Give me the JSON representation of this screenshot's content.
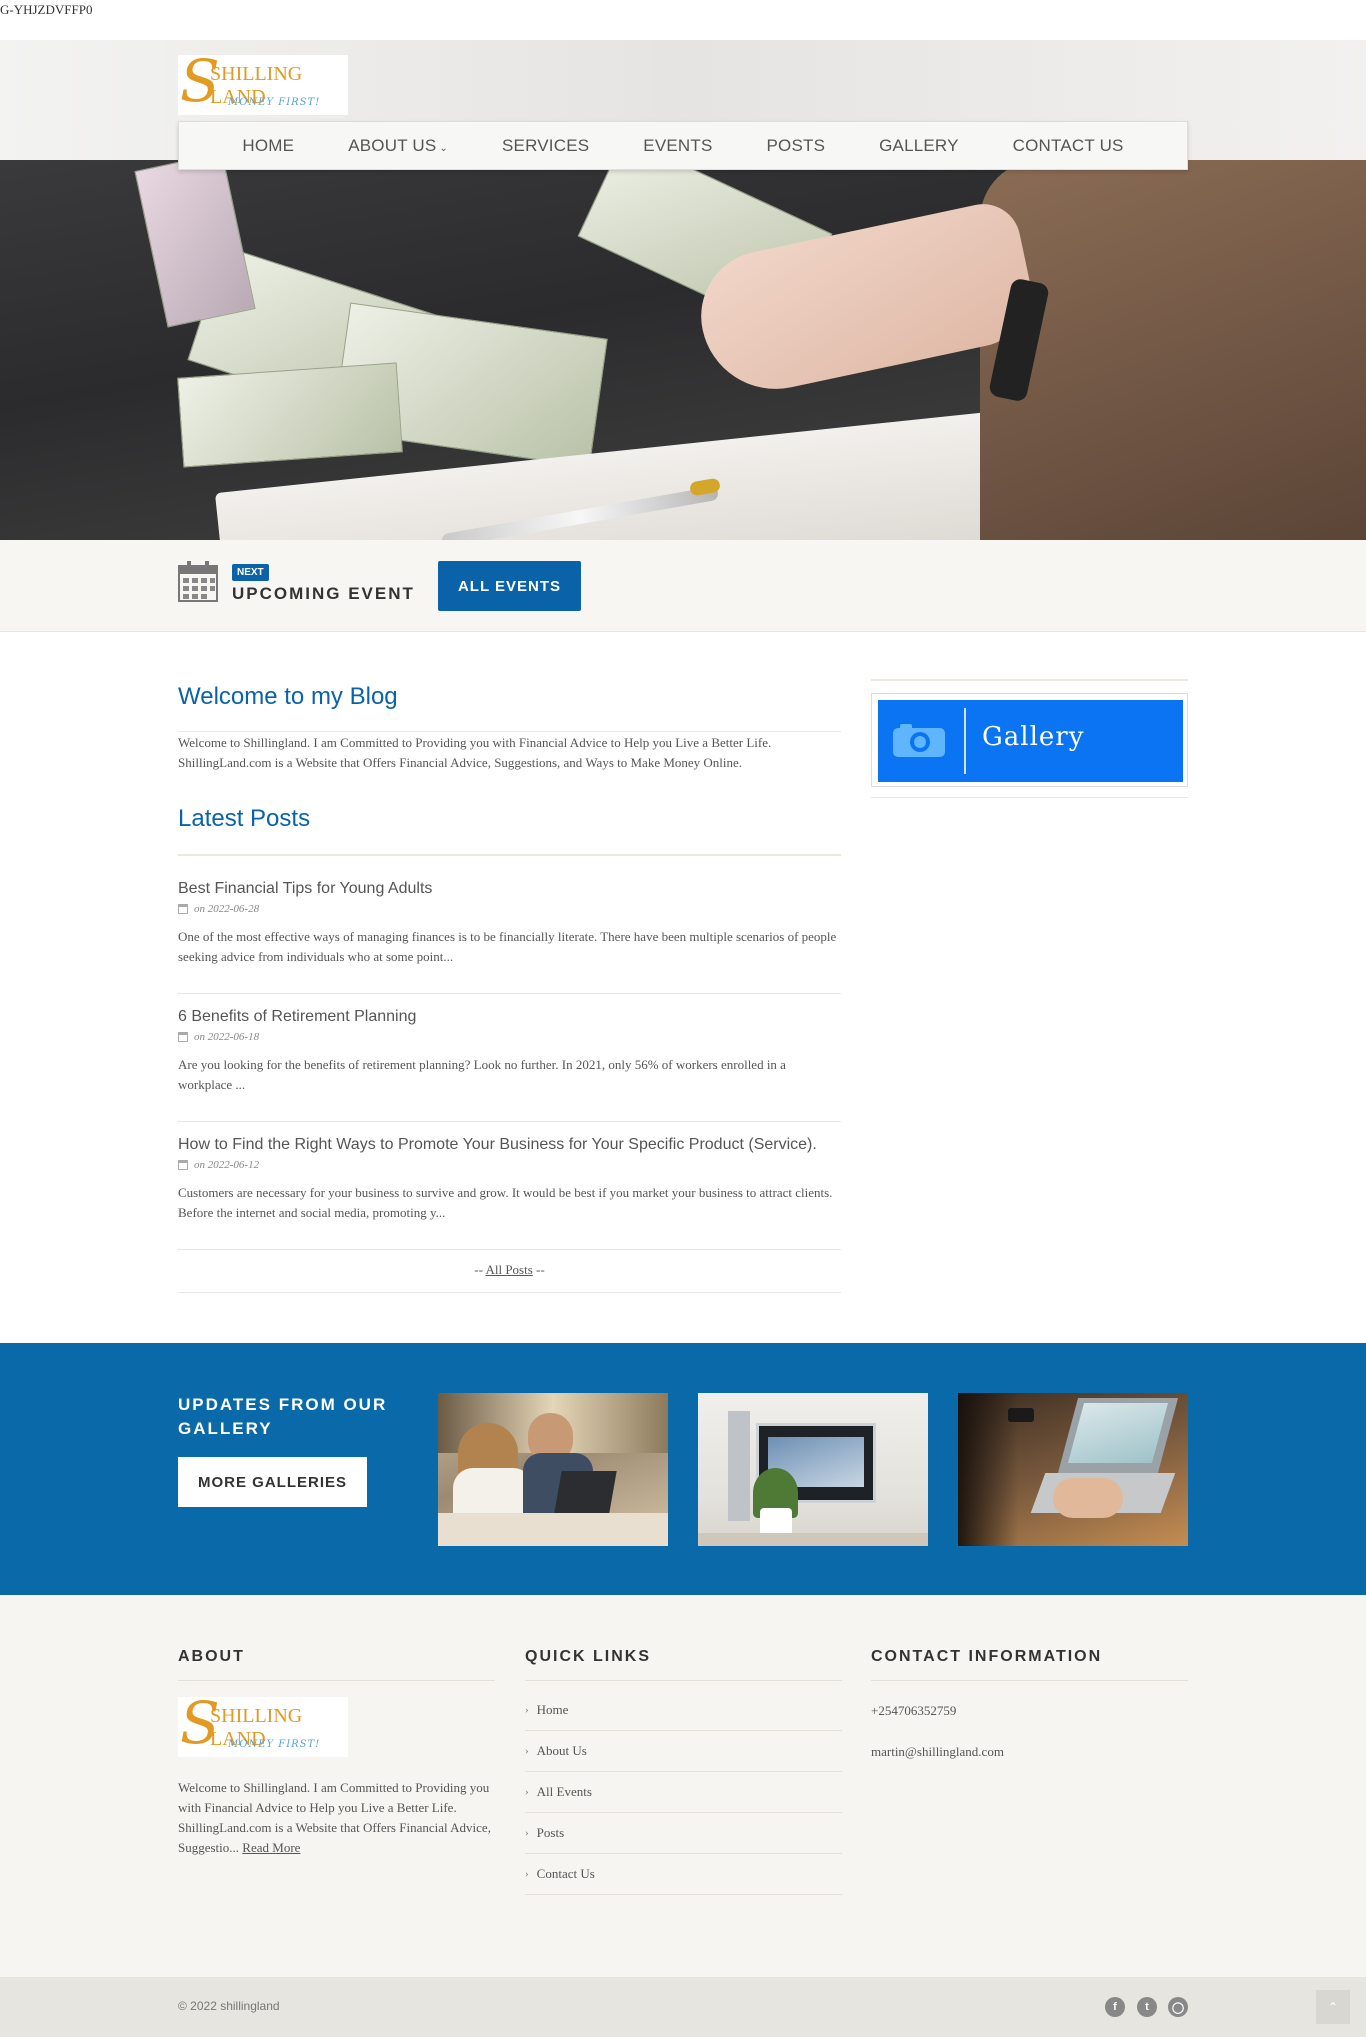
{
  "tracking_text": "G-YHJZDVFFP0",
  "logo": {
    "name": "SHILLING LAND",
    "tagline": "MONEY FIRST!"
  },
  "nav": {
    "items": [
      {
        "label": "HOME"
      },
      {
        "label": "ABOUT US"
      },
      {
        "label": "SERVICES"
      },
      {
        "label": "EVENTS"
      },
      {
        "label": "POSTS"
      },
      {
        "label": "GALLERY"
      },
      {
        "label": "CONTACT US"
      }
    ]
  },
  "event_bar": {
    "badge": "NEXT",
    "title": "UPCOMING EVENT",
    "button": "ALL EVENTS"
  },
  "welcome": {
    "title": "Welcome to my Blog",
    "text": "Welcome to Shillingland. I am Committed to Providing you with Financial Advice to Help you Live a Better Life. ShillingLand.com is a Website that Offers Financial Advice, Suggestions, and Ways to Make Money Online."
  },
  "latest": {
    "title": "Latest Posts",
    "posts": [
      {
        "title": "Best Financial Tips for Young Adults",
        "date": "on 2022-06-28",
        "excerpt": "One of the most effective ways of managing finances is to be financially literate. There have been multiple scenarios of people seeking advice from individuals who at some point..."
      },
      {
        "title": "6 Benefits of Retirement Planning",
        "date": "on 2022-06-18",
        "excerpt": "Are you looking for the benefits of retirement planning? Look no further. In 2021, only 56% of workers enrolled in a workplace ..."
      },
      {
        "title": "How to Find the Right Ways to Promote Your Business for Your Specific Product (Service).",
        "date": "on 2022-06-12",
        "excerpt": "Customers are necessary for your business to survive and grow. It would be best if you market your business to attract clients. Before the internet and social media, promoting y..."
      }
    ],
    "all_posts_prefix": "-- ",
    "all_posts_label": "All Posts",
    "all_posts_suffix": " --"
  },
  "sidebar": {
    "gallery_label": "Gallery"
  },
  "gallery_band": {
    "title": "UPDATES FROM OUR GALLERY",
    "button": "MORE GALLERIES"
  },
  "footer": {
    "about_title": "ABOUT",
    "about_text": "Welcome to Shillingland. I am Committed to Providing you with Financial Advice to Help you Live a Better Life. ShillingLand.com is a Website that Offers Financial Advice, Suggestio...",
    "read_more": "Read More",
    "quick_links_title": "QUICK LINKS",
    "quick_links": [
      {
        "label": "Home"
      },
      {
        "label": "About Us"
      },
      {
        "label": "All Events"
      },
      {
        "label": "Posts"
      },
      {
        "label": "Contact Us"
      }
    ],
    "contact_title": "CONTACT INFORMATION",
    "phone": "+254706352759",
    "email": "martin@shillingland.com"
  },
  "bottom": {
    "copyright": "© 2022 shillingland"
  },
  "colors": {
    "brand_blue": "#0a63a8",
    "logo_orange": "#e39a22",
    "gallery_blue": "#0a74f2"
  }
}
